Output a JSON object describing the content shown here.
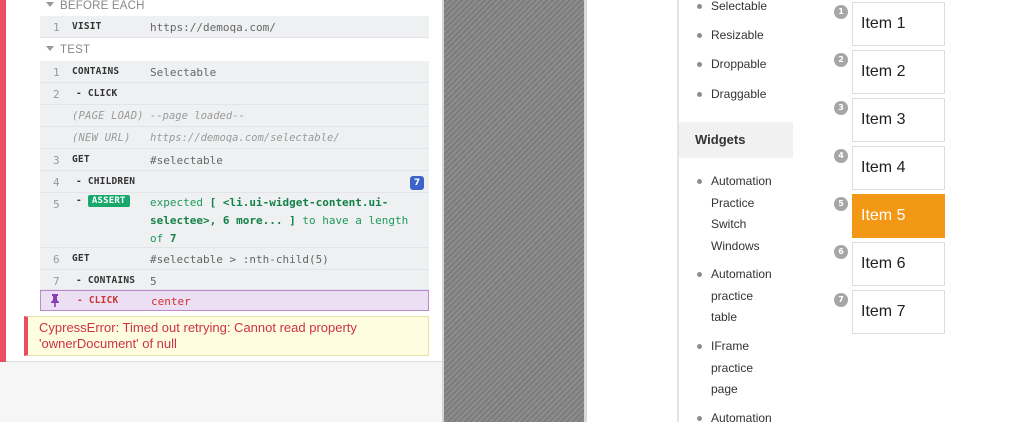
{
  "runner": {
    "hooks": {
      "before_each": "BEFORE EACH",
      "test": "TEST"
    },
    "before_each_commands": [
      {
        "num": "1",
        "name": "VISIT",
        "message": "https://demoqa.com/"
      }
    ],
    "test_commands": [
      {
        "num": "1",
        "name": "CONTAINS",
        "message": "Selectable"
      },
      {
        "num": "2",
        "name": "- CLICK",
        "message": ""
      },
      {
        "num": "",
        "name": "(PAGE LOAD)",
        "message": "--page loaded--"
      },
      {
        "num": "",
        "name": "(NEW URL)",
        "message": "https://demoqa.com/selectable/"
      },
      {
        "num": "3",
        "name": "GET",
        "message": "#selectable"
      },
      {
        "num": "4",
        "name": "- CHILDREN",
        "message": "",
        "count": "7"
      },
      {
        "num": "5",
        "name": "ASSERT",
        "message_parts": [
          "expected ",
          "[ <li.ui-widget-content.ui-selectee>, 6 more... ]",
          " to have a length of ",
          "7"
        ]
      },
      {
        "num": "6",
        "name": "GET",
        "message": "#selectable > :nth-child(5)"
      },
      {
        "num": "7",
        "name": "- CONTAINS",
        "message": "5"
      },
      {
        "num": "",
        "name": "- CLICK",
        "message": "center"
      }
    ],
    "error": "CypressError: Timed out retrying: Cannot read property 'ownerDocument' of null",
    "colors": {
      "fail": "#e94f5f",
      "pinned": "#ecdff3",
      "assert": "#18a86b"
    }
  },
  "app": {
    "sidebar_items_top": [
      "Selectable",
      "Resizable",
      "Droppable",
      "Draggable"
    ],
    "sidebar_section": "Widgets",
    "sidebar_items_bottom": [
      "Automation Practice Switch Windows",
      "Automation practice table",
      "IFrame practice page",
      "Automation"
    ],
    "selectable": {
      "items": [
        {
          "step": "1",
          "label": "Item 1",
          "selected": false
        },
        {
          "step": "2",
          "label": "Item 2",
          "selected": false
        },
        {
          "step": "3",
          "label": "Item 3",
          "selected": false
        },
        {
          "step": "4",
          "label": "Item 4",
          "selected": false
        },
        {
          "step": "5",
          "label": "Item 5",
          "selected": true
        },
        {
          "step": "6",
          "label": "Item 6",
          "selected": false
        },
        {
          "step": "7",
          "label": "Item 7",
          "selected": false
        }
      ],
      "selected_color": "#f39814"
    }
  }
}
